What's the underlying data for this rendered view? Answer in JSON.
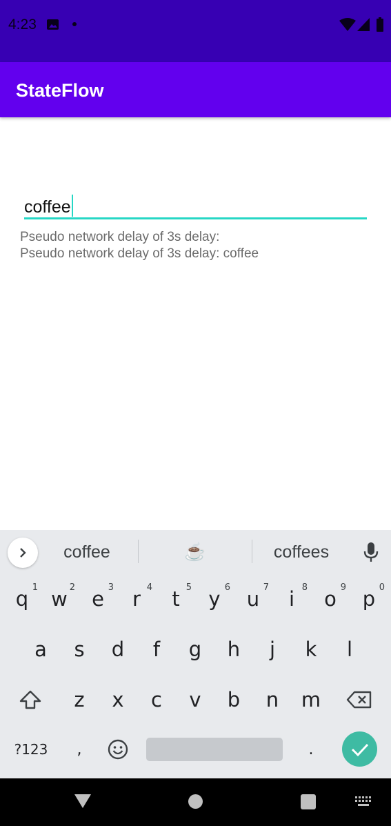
{
  "status_bar": {
    "time": "4:23"
  },
  "app_bar": {
    "title": "StateFlow"
  },
  "search": {
    "value": "coffee"
  },
  "results": {
    "line1": "Pseudo network delay of 3s delay:",
    "line2": "Pseudo network delay of 3s delay: coffee"
  },
  "keyboard": {
    "suggestions": [
      "coffee",
      "☕",
      "coffees"
    ],
    "row1": [
      {
        "key": "q",
        "hint": "1"
      },
      {
        "key": "w",
        "hint": "2"
      },
      {
        "key": "e",
        "hint": "3"
      },
      {
        "key": "r",
        "hint": "4"
      },
      {
        "key": "t",
        "hint": "5"
      },
      {
        "key": "y",
        "hint": "6"
      },
      {
        "key": "u",
        "hint": "7"
      },
      {
        "key": "i",
        "hint": "8"
      },
      {
        "key": "o",
        "hint": "9"
      },
      {
        "key": "p",
        "hint": "0"
      }
    ],
    "row2": [
      "a",
      "s",
      "d",
      "f",
      "g",
      "h",
      "j",
      "k",
      "l"
    ],
    "row3": [
      "z",
      "x",
      "c",
      "v",
      "b",
      "n",
      "m"
    ],
    "symbols_label": "?123",
    "comma_label": ",",
    "period_label": "."
  },
  "colors": {
    "status_bar": "#3700b3",
    "app_bar": "#6200ee",
    "accent": "#26d7c5",
    "enter_key": "#3ebba3"
  },
  "icons": [
    "image-icon",
    "notification-dot-icon",
    "wifi-icon",
    "signal-icon",
    "battery-icon",
    "chevron-right-icon",
    "microphone-icon",
    "shift-icon",
    "backspace-icon",
    "emoji-icon",
    "check-icon",
    "nav-back-icon",
    "nav-home-icon",
    "nav-recents-icon",
    "keyboard-switch-icon"
  ]
}
